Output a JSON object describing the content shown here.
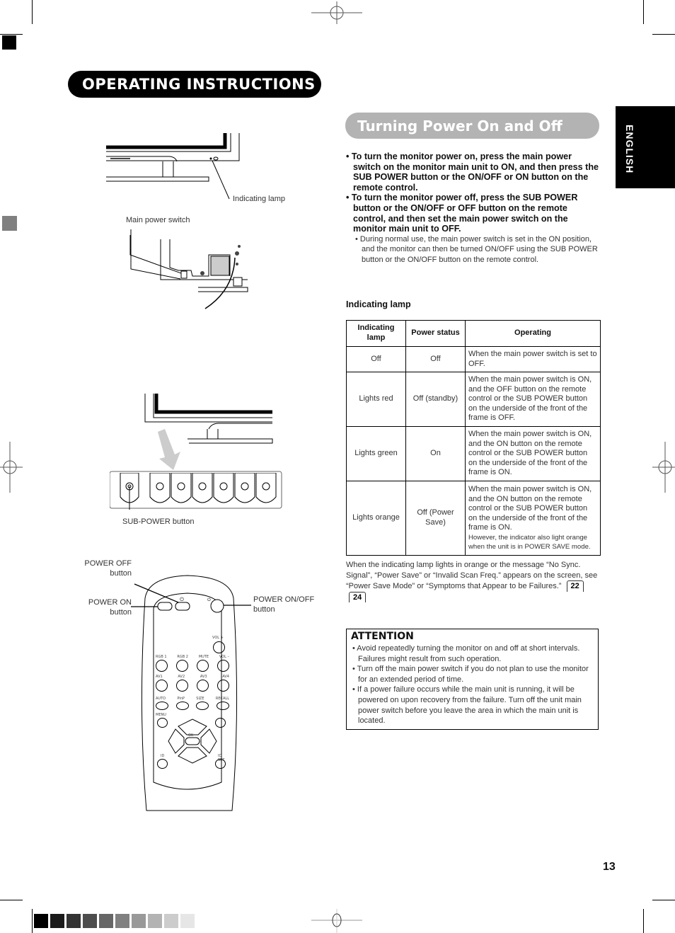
{
  "header": {
    "title": "OPERATING INSTRUCTIONS",
    "language_tab": "ENGLISH"
  },
  "section": {
    "title": "Turning Power On and Off",
    "steps": [
      "• To turn the monitor power on, press the main power switch on the monitor main unit to ON, and then press the SUB POWER button or the ON/OFF or ON button on the remote control.",
      "• To turn the monitor power off, press the SUB POWER button or the ON/OFF or OFF button on the remote control, and then set the main power switch on the monitor main unit to OFF."
    ],
    "subnote": "• During normal use, the main power switch is set in the ON position, and the monitor can then be turned ON/OFF using the SUB POWER button or the ON/OFF button on the remote control."
  },
  "lamp_table": {
    "heading": "Indicating lamp",
    "columns": [
      "Indicating lamp",
      "Power status",
      "Operating"
    ],
    "rows": [
      {
        "lamp": "Off",
        "status": "Off",
        "operating": "When the main power switch is set to OFF.",
        "extra": ""
      },
      {
        "lamp": "Lights red",
        "status": "Off (standby)",
        "operating": "When the main power switch is ON, and the OFF button on the remote control or the SUB POWER button on the underside of the front of the frame is OFF.",
        "extra": ""
      },
      {
        "lamp": "Lights green",
        "status": "On",
        "operating": "When the main power switch is ON, and the ON button on the remote control or the SUB POWER button on the underside of the front of the frame is ON.",
        "extra": ""
      },
      {
        "lamp": "Lights  orange",
        "status": "Off (Power Save)",
        "operating": "When the main power switch is ON, and the ON button on the remote control or the SUB POWER button on the underside of the front of the frame is ON.",
        "extra": "However, the indicator also light orange when the unit is in POWER SAVE mode."
      }
    ]
  },
  "note": {
    "text": "When the indicating lamp lights in orange or the message “No Sync. Signal”, “Power Save” or “Invalid Scan Freq.” appears on the screen, see “Power Save Mode” or “Symptoms that Appear to be Failures.”",
    "page_refs": [
      "22",
      "24"
    ]
  },
  "attention": {
    "title": "ATTENTION",
    "items": [
      "• Avoid repeatedly turning the monitor on and off at short intervals. Failures might result from such operation.",
      "• Turn off the main power switch if you do not plan to use the monitor for an extended period of time.",
      "• If a power failure occurs while the main unit is running, it will be powered on upon recovery from the failure. Turn off the unit main power switch before you leave the area in which the main unit is located."
    ]
  },
  "illustrations": {
    "indicating_lamp_label": "Indicating lamp",
    "main_power_switch_label": "Main power switch",
    "sub_power_label": "SUB-POWER button",
    "power_off_label": "POWER OFF button",
    "power_on_label": "POWER ON button",
    "power_onoff_label": "POWER ON/OFF button",
    "remote_buttons": {
      "row1": [
        "RGB 1",
        "RGB 2",
        "MUTE",
        "VOL –"
      ],
      "row2": [
        "AV1",
        "AV2",
        "AV3",
        "AV4"
      ],
      "row3": [
        "AUTO",
        "PinP",
        "SIZE",
        "RECALL"
      ],
      "vol_plus": "VOL +",
      "menu": "MENU",
      "ok": "OK",
      "id": "ID",
      "id_set": "ID SET"
    }
  },
  "footer": {
    "page_number": "13",
    "swatches": [
      "#000000",
      "#1a1a1a",
      "#333333",
      "#4d4d4d",
      "#666666",
      "#808080",
      "#999999",
      "#b3b3b3",
      "#cccccc",
      "#e6e6e6"
    ]
  }
}
